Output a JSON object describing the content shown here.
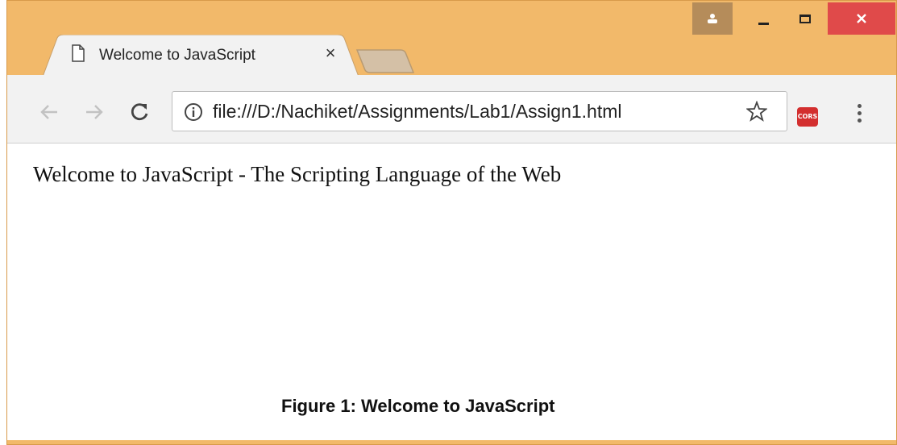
{
  "window": {
    "frame_color": "#f2b96a",
    "close_color": "#e04a4a"
  },
  "tabs": [
    {
      "title": "Welcome to JavaScript",
      "close_glyph": "×"
    }
  ],
  "toolbar": {
    "url": "file:///D:/Nachiket/Assignments/Lab1/Assign1.html",
    "extension_label": "CORS"
  },
  "page": {
    "heading": "Welcome to JavaScript - The Scripting Language of the Web"
  },
  "figure": {
    "caption": "Figure 1: Welcome to JavaScript"
  }
}
